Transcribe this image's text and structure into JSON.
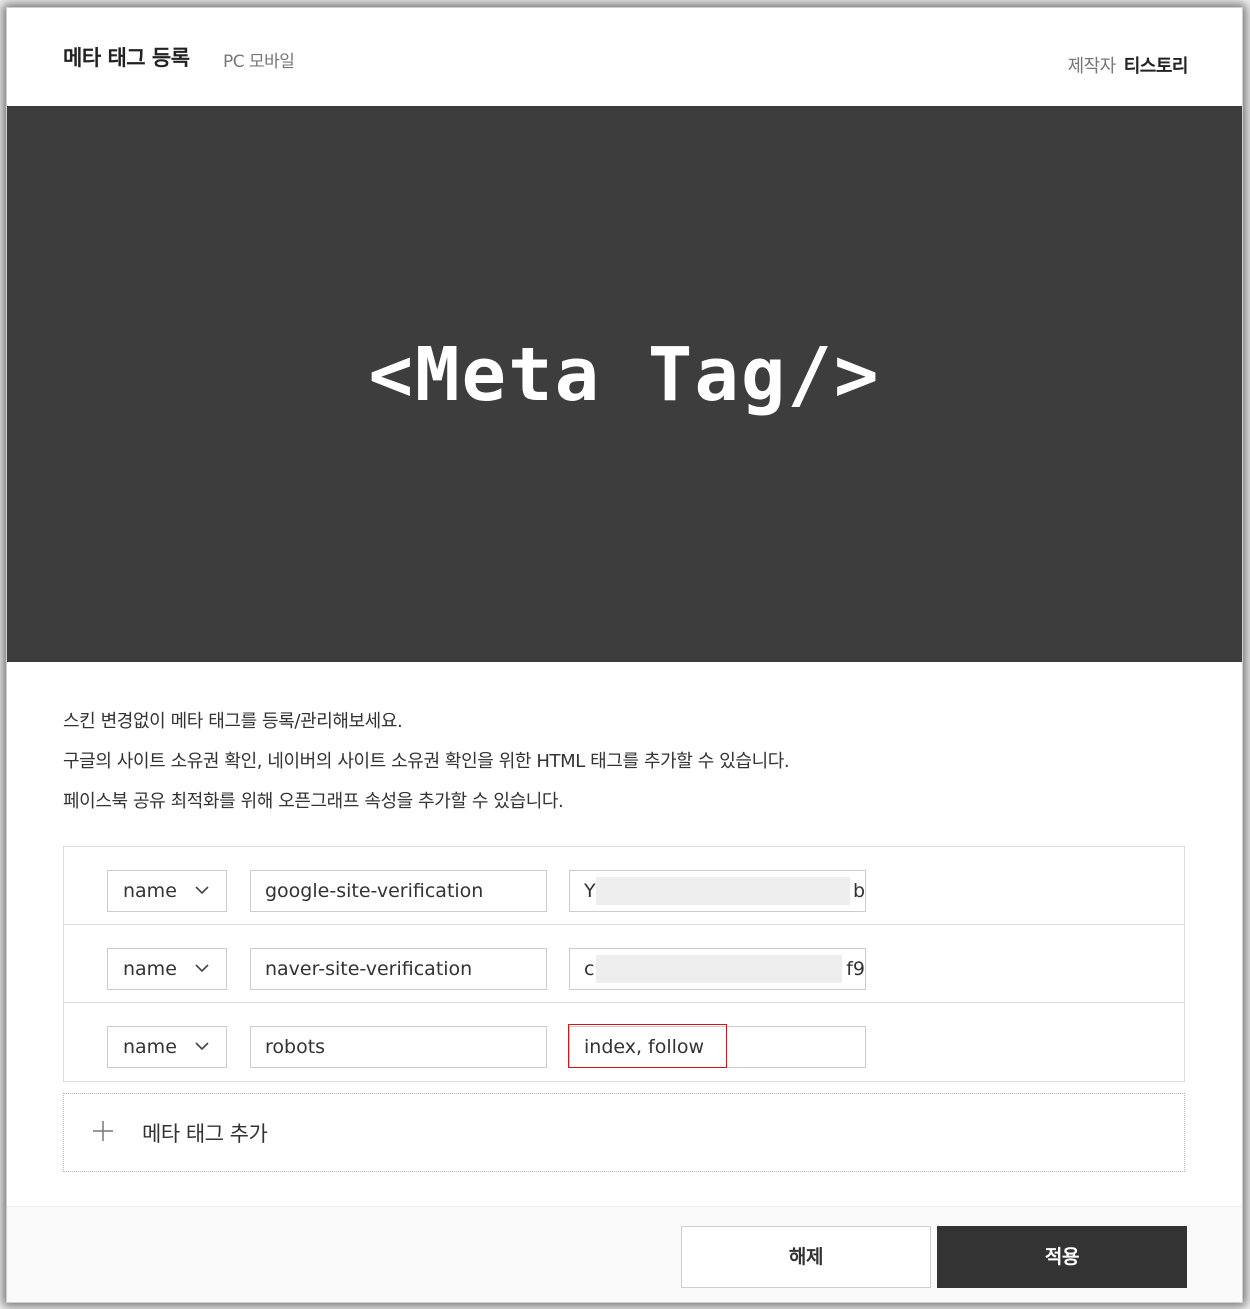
{
  "header": {
    "title": "메타 태그 등록",
    "subtitle": "PC 모바일",
    "author_label": "제작자",
    "author_name": "티스토리"
  },
  "banner": {
    "text": "<Meta Tag/>"
  },
  "description": {
    "lines": [
      "스킨 변경없이 메타 태그를 등록/관리해보세요.",
      "구글의 사이트 소유권 확인, 네이버의 사이트 소유권 확인을 위한 HTML 태그를 추가할 수 있습니다.",
      "페이스북 공유 최적화를 위해 오픈그래프 속성을 추가할 수 있습니다."
    ]
  },
  "meta_rows": [
    {
      "type": "name",
      "key": "google-site-verification",
      "value_start": "Y",
      "value_end": "b",
      "redacted": true
    },
    {
      "type": "name",
      "key": "naver-site-verification",
      "value_start": "c",
      "value_end": "f9",
      "redacted": true
    },
    {
      "type": "name",
      "key": "robots",
      "value_start": "index, follow",
      "value_end": "",
      "redacted": false,
      "highlighted": true
    }
  ],
  "add_row": {
    "label": "메타 태그 추가"
  },
  "footer": {
    "cancel_label": "해제",
    "apply_label": "적용"
  },
  "colors": {
    "banner_bg": "#3d3d3d",
    "apply_bg": "#333333",
    "highlight": "#d0161c"
  }
}
